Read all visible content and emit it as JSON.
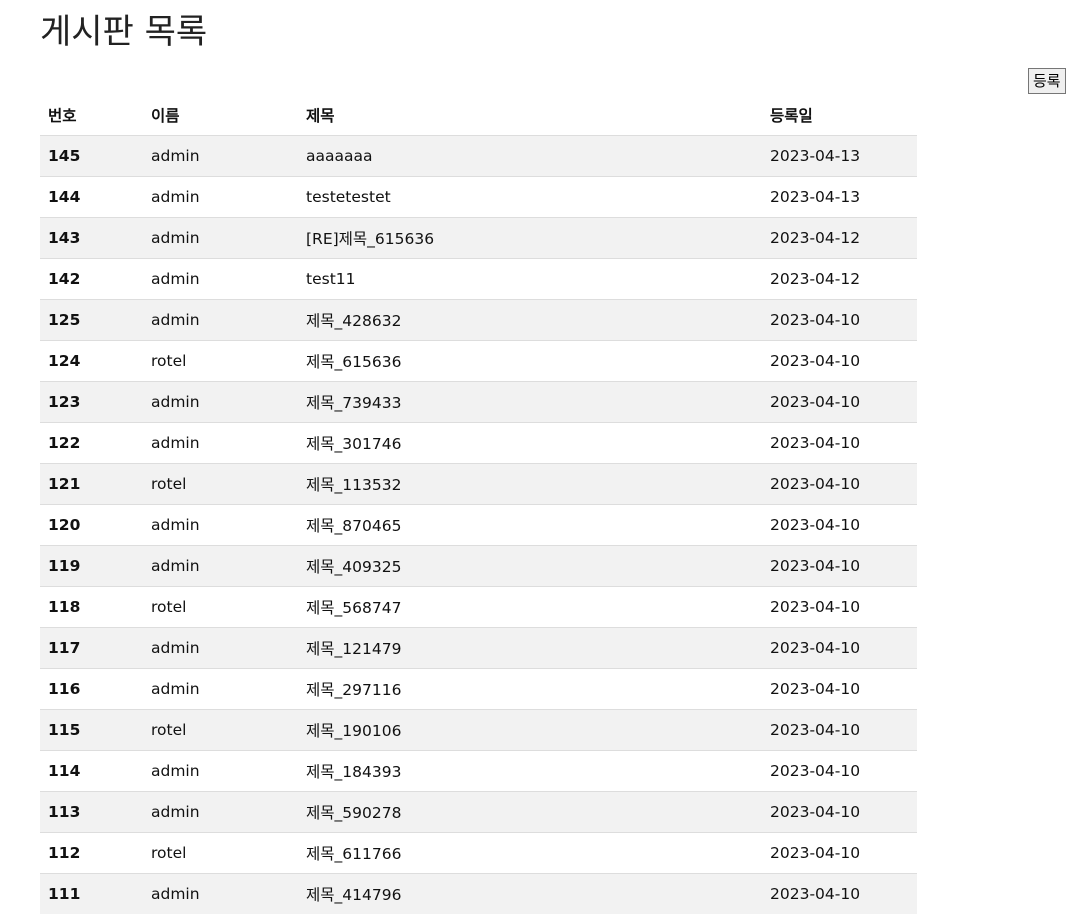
{
  "page": {
    "title": "게시판 목록"
  },
  "actions": {
    "register_label": "등록"
  },
  "table": {
    "columns": [
      "번호",
      "이름",
      "제목",
      "등록일"
    ],
    "rows": [
      {
        "num": "145",
        "name": "admin",
        "title": "aaaaaaa",
        "date": "2023-04-13"
      },
      {
        "num": "144",
        "name": "admin",
        "title": "testetestet",
        "date": "2023-04-13"
      },
      {
        "num": "143",
        "name": "admin",
        "title": "[RE]제목_615636",
        "date": "2023-04-12"
      },
      {
        "num": "142",
        "name": "admin",
        "title": "test11",
        "date": "2023-04-12"
      },
      {
        "num": "125",
        "name": "admin",
        "title": "제목_428632",
        "date": "2023-04-10"
      },
      {
        "num": "124",
        "name": "rotel",
        "title": "제목_615636",
        "date": "2023-04-10"
      },
      {
        "num": "123",
        "name": "admin",
        "title": "제목_739433",
        "date": "2023-04-10"
      },
      {
        "num": "122",
        "name": "admin",
        "title": "제목_301746",
        "date": "2023-04-10"
      },
      {
        "num": "121",
        "name": "rotel",
        "title": "제목_113532",
        "date": "2023-04-10"
      },
      {
        "num": "120",
        "name": "admin",
        "title": "제목_870465",
        "date": "2023-04-10"
      },
      {
        "num": "119",
        "name": "admin",
        "title": "제목_409325",
        "date": "2023-04-10"
      },
      {
        "num": "118",
        "name": "rotel",
        "title": "제목_568747",
        "date": "2023-04-10"
      },
      {
        "num": "117",
        "name": "admin",
        "title": "제목_121479",
        "date": "2023-04-10"
      },
      {
        "num": "116",
        "name": "admin",
        "title": "제목_297116",
        "date": "2023-04-10"
      },
      {
        "num": "115",
        "name": "rotel",
        "title": "제목_190106",
        "date": "2023-04-10"
      },
      {
        "num": "114",
        "name": "admin",
        "title": "제목_184393",
        "date": "2023-04-10"
      },
      {
        "num": "113",
        "name": "admin",
        "title": "제목_590278",
        "date": "2023-04-10"
      },
      {
        "num": "112",
        "name": "rotel",
        "title": "제목_611766",
        "date": "2023-04-10"
      },
      {
        "num": "111",
        "name": "admin",
        "title": "제목_414796",
        "date": "2023-04-10"
      }
    ]
  }
}
